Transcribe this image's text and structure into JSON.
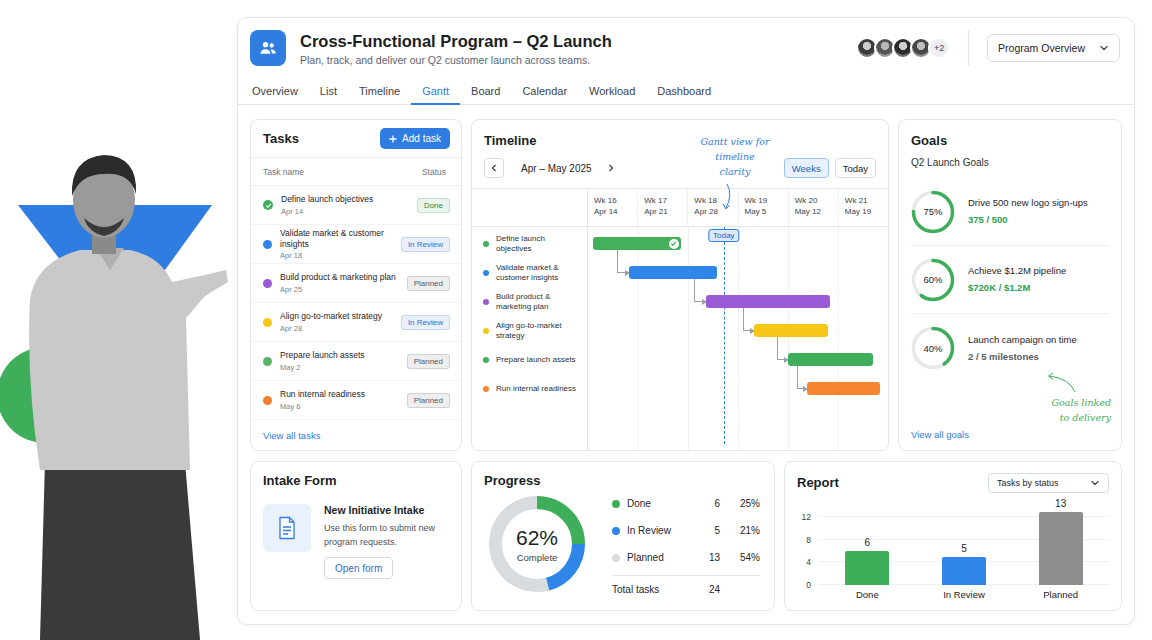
{
  "header": {
    "title": "Cross-Functional Program – Q2 Launch",
    "subtitle": "Plan, track, and deliver our Q2 customer launch across teams.",
    "members_more": "+2",
    "view_select": "Program Overview"
  },
  "tabs": [
    {
      "label": "Overview",
      "selected": false
    },
    {
      "label": "List",
      "selected": false
    },
    {
      "label": "Timeline",
      "selected": false
    },
    {
      "label": "Gantt",
      "selected": true
    },
    {
      "label": "Board",
      "selected": false
    },
    {
      "label": "Calendar",
      "selected": false
    },
    {
      "label": "Workload",
      "selected": false
    },
    {
      "label": "Dashboard",
      "selected": false
    }
  ],
  "tasks": {
    "title": "Tasks",
    "add_button": "Add task",
    "columns": [
      "Task name",
      "Status"
    ],
    "rows": [
      {
        "name": "Define launch objectives",
        "date": "Apr 14",
        "status": "Done",
        "done": true,
        "color": "#3fae5a",
        "status_color": "#2e8b47"
      },
      {
        "name": "Validate market & customer insights",
        "date": "Apr 18",
        "status": "In Review",
        "done": false,
        "color": "#2f86e8",
        "status_color": "#2f6fd0"
      },
      {
        "name": "Build product & marketing plan",
        "date": "Apr 25",
        "status": "Planned",
        "done": false,
        "color": "#9b5bd6",
        "status_color": "#555b63"
      },
      {
        "name": "Align go-to-market strategy",
        "date": "Apr 28",
        "status": "In Review",
        "done": false,
        "color": "#f5c518",
        "status_color": "#2f6fd0"
      },
      {
        "name": "Prepare launch assets",
        "date": "May 2",
        "status": "Planned",
        "done": false,
        "color": "#58b368",
        "status_color": "#555b63"
      },
      {
        "name": "Run internal readiness",
        "date": "May 6",
        "status": "Planned",
        "done": false,
        "color": "#f07f2e",
        "status_color": "#555b63"
      }
    ],
    "view_all": "View all tasks"
  },
  "timeline": {
    "title": "Timeline",
    "range": "Apr – May 2025",
    "view_buttons": [
      {
        "label": "Weeks",
        "selected": true
      },
      {
        "label": "Today",
        "selected": false
      }
    ],
    "weeks": [
      {
        "week": "Wk 16",
        "date": "Apr 14"
      },
      {
        "week": "Wk 17",
        "date": "Apr 21"
      },
      {
        "week": "Wk 18",
        "date": "Apr 28"
      },
      {
        "week": "Wk 19",
        "date": "May 5"
      },
      {
        "week": "Wk 20",
        "date": "May 12"
      },
      {
        "week": "Wk 21",
        "date": "May 19"
      }
    ],
    "span_days": 42,
    "today_day": 19,
    "today_label": "Today",
    "annotation": "Gantt view for timeline clarity",
    "rows": [
      {
        "label": "Define launch objectives",
        "color": "#43b05c",
        "start": 0.7,
        "end": 13,
        "done": true
      },
      {
        "label": "Validate market & customer insights",
        "color": "#2f86e8",
        "start": 5.7,
        "end": 18,
        "done": false
      },
      {
        "label": "Build product & marketing plan",
        "color": "#9b5bd6",
        "start": 16.5,
        "end": 33.9,
        "done": false
      },
      {
        "label": "Align go-to-market strategy",
        "color": "#f6c619",
        "start": 23.3,
        "end": 33.6,
        "done": false
      },
      {
        "label": "Prepare launch assets",
        "color": "#3fae5a",
        "start": 28,
        "end": 39.9,
        "done": false
      },
      {
        "label": "Run internal readiness",
        "color": "#f5862f",
        "start": 30.7,
        "end": 40.9,
        "done": false
      }
    ]
  },
  "goals": {
    "title": "Goals",
    "subtitle": "Q2 Launch Goals",
    "items": [
      {
        "percent": "75%",
        "level": 0.75,
        "title": "Drive 500 new logo sign-ups",
        "value": "375 / 500",
        "color": "#2e9e4f"
      },
      {
        "percent": "60%",
        "level": 0.6,
        "title": "Achieve $1.2M pipeline",
        "value": "$720K / $1.2M",
        "color": "#2e9e4f"
      },
      {
        "percent": "40%",
        "level": 0.4,
        "title": "Launch campaign on time",
        "value": "2 / 5 milestones",
        "color": "#555b63"
      }
    ],
    "view_all": "View all goals",
    "annotation": "Goals linked to delivery"
  },
  "intake": {
    "title": "Intake Form",
    "form_title": "New Initiative Intake",
    "description": "Use this form to submit new program requests.",
    "button": "Open form"
  },
  "progress": {
    "title": "Progress",
    "center_value": "62%",
    "center_label": "Complete",
    "legend": [
      {
        "label": "Done",
        "count": "6",
        "percent": "25%",
        "value": 6,
        "color": "#3fae5a"
      },
      {
        "label": "In Review",
        "count": "5",
        "percent": "21%",
        "value": 5,
        "color": "#2f86e8"
      },
      {
        "label": "Planned",
        "count": "13",
        "percent": "54%",
        "value": 13,
        "color": "#d9dcdf"
      }
    ],
    "total_label": "Total tasks",
    "total": "24"
  },
  "report": {
    "title": "Report",
    "select": "Tasks by status",
    "y_ticks": [
      {
        "label": "12",
        "value": 12
      },
      {
        "label": "8",
        "value": 8
      },
      {
        "label": "4",
        "value": 4
      },
      {
        "label": "0",
        "value": 0
      }
    ],
    "bars": [
      {
        "label": "Done",
        "value": 6,
        "value_text": "6",
        "color": "#3fae5a"
      },
      {
        "label": "In Review",
        "value": 5,
        "value_text": "5",
        "color": "#2f86e8"
      },
      {
        "label": "Planned",
        "value": 13,
        "value_text": "13",
        "color": "#8e8e8e"
      }
    ]
  }
}
